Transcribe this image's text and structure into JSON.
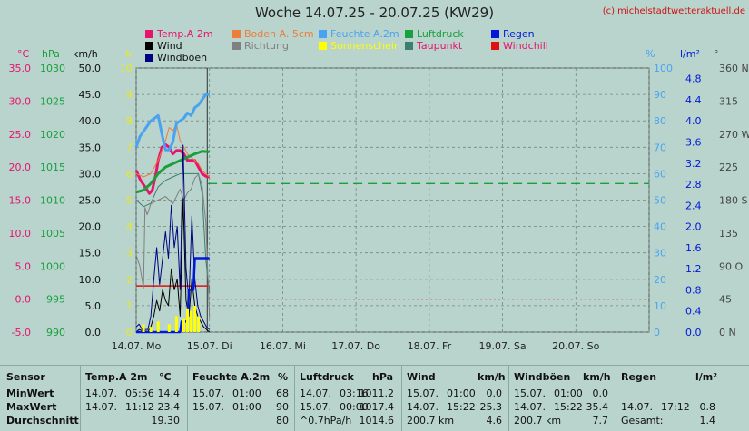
{
  "title": "Woche 14.07.25 - 20.07.25 (KW29)",
  "copyright": "(c) michelstadtwetteraktuell.de",
  "legend": [
    {
      "label": "Temp.A 2m",
      "color": "#e8136e",
      "text_color": "#e8136e"
    },
    {
      "label": "Boden A. 5cm",
      "color": "#ee7d3a",
      "text_color": "#ee7d3a"
    },
    {
      "label": "Feuchte A.2m",
      "color": "#4aa3f0",
      "text_color": "#4aa3f0"
    },
    {
      "label": "Luftdruck",
      "color": "#18a03c",
      "text_color": "#18a03c"
    },
    {
      "label": "Regen",
      "color": "#0018d8",
      "text_color": "#0018d8"
    },
    {
      "label": "Wind",
      "color": "#000000",
      "text_color": "#111111"
    },
    {
      "label": "Richtung",
      "color": "#808080",
      "text_color": "#808080"
    },
    {
      "label": "Sonnenschein",
      "color": "#ffff00",
      "text_color": "#ffff00"
    },
    {
      "label": "Taupunkt",
      "color": "#3e7e6e",
      "text_color": "#e8136e"
    },
    {
      "label": "Windchill",
      "color": "#e01010",
      "text_color": "#e8136e"
    },
    {
      "label": "Windböen",
      "color": "#000080",
      "text_color": "#111111"
    }
  ],
  "axis_units": {
    "celsius": "°C",
    "hpa": "hPa",
    "kmh": "km/h",
    "h": "h",
    "percent": "%",
    "rain": "l/m²",
    "deg": "°"
  },
  "chart_data": {
    "type": "line",
    "x_labels": [
      "14.07. Mo",
      "15.07. Di",
      "16.07. Mi",
      "17.07. Do",
      "18.07. Fr",
      "19.07. Sa",
      "20.07. So"
    ],
    "axes": {
      "celsius": {
        "ticks": [
          "35.0",
          "30.0",
          "25.0",
          "20.0",
          "15.0",
          "10.0",
          "5.0",
          "0.0",
          "-5.0"
        ],
        "range": [
          -5,
          35
        ]
      },
      "hpa": {
        "ticks": [
          "1030",
          "1025",
          "1020",
          "1015",
          "1010",
          "1005",
          "1000",
          "995",
          "990"
        ],
        "range": [
          990,
          1030
        ]
      },
      "kmh": {
        "ticks": [
          "50.0",
          "45.0",
          "40.0",
          "35.0",
          "30.0",
          "25.0",
          "20.0",
          "15.0",
          "10.0",
          "5.0",
          "0.0"
        ],
        "range": [
          0,
          50
        ]
      },
      "hours": {
        "ticks": [
          "10",
          "9",
          "8",
          "7",
          "6",
          "5",
          "4",
          "3",
          "2",
          "1",
          "0"
        ],
        "range": [
          0,
          10
        ]
      },
      "percent": {
        "ticks": [
          "100",
          "90",
          "80",
          "70",
          "60",
          "50",
          "40",
          "30",
          "20",
          "10",
          "0"
        ],
        "range": [
          0,
          100
        ]
      },
      "rain": {
        "ticks": [
          "4.8",
          "4.4",
          "4.0",
          "3.6",
          "3.2",
          "2.8",
          "2.4",
          "2.0",
          "1.6",
          "1.2",
          "0.8",
          "0.4",
          "0.0"
        ],
        "range": [
          0,
          5
        ]
      },
      "direction": {
        "ticks": [
          "360 N",
          "315",
          "270 W",
          "225",
          "180 S",
          "135",
          "90 O",
          "45",
          "0 N"
        ],
        "range": [
          0,
          360
        ]
      }
    },
    "series": [
      {
        "name": "Temp.A 2m",
        "axis": "celsius",
        "x": [
          0,
          0.06,
          0.12,
          0.18,
          0.22,
          0.27,
          0.3,
          0.35,
          0.4,
          0.45,
          0.5,
          0.55,
          0.6,
          0.65,
          0.7,
          0.75,
          0.8,
          0.85,
          0.9,
          0.95,
          1.0
        ],
        "values": [
          19.5,
          18,
          17,
          16,
          16.5,
          19,
          21,
          23,
          23.4,
          23,
          22,
          22.5,
          22.5,
          22,
          21,
          21,
          21,
          20,
          19,
          18.6,
          18.5
        ]
      },
      {
        "name": "Boden A. 5cm",
        "axis": "celsius",
        "x": [
          0,
          0.1,
          0.2,
          0.3,
          0.4,
          0.45,
          0.5,
          0.55,
          0.6,
          0.65,
          0.7,
          0.75,
          0.8,
          0.85,
          0.9,
          0.95,
          1.0
        ],
        "values": [
          19,
          18.5,
          19,
          21,
          24,
          26,
          25.5,
          26.5,
          24,
          23,
          22,
          21.5,
          21,
          20.5,
          19.5,
          19,
          18.5
        ]
      },
      {
        "name": "Feuchte A.2m",
        "axis": "percent",
        "x": [
          0,
          0.05,
          0.1,
          0.15,
          0.2,
          0.25,
          0.3,
          0.35,
          0.4,
          0.45,
          0.5,
          0.55,
          0.6,
          0.65,
          0.7,
          0.75,
          0.8,
          0.85,
          0.9,
          0.95,
          1.0
        ],
        "values": [
          70,
          74,
          76,
          78,
          80,
          81,
          82,
          75,
          69,
          69,
          72,
          79,
          80,
          81,
          83,
          82,
          85,
          86,
          88,
          90,
          90
        ]
      },
      {
        "name": "Luftdruck",
        "axis": "hpa",
        "x": [
          0,
          0.1,
          0.2,
          0.3,
          0.4,
          0.5,
          0.6,
          0.7,
          0.8,
          0.9,
          1.0
        ],
        "values": [
          1011.2,
          1011.5,
          1012.5,
          1014,
          1015,
          1015.5,
          1016,
          1016.5,
          1017,
          1017.4,
          1017.3
        ]
      },
      {
        "name": "Taupunkt",
        "axis": "celsius",
        "x": [
          0,
          0.1,
          0.2,
          0.3,
          0.4,
          0.5,
          0.6,
          0.7,
          0.8,
          0.85,
          0.9,
          0.95,
          1.0
        ],
        "values": [
          15,
          14,
          14.5,
          17,
          18,
          18.5,
          19,
          19,
          19,
          19,
          16,
          6,
          1
        ]
      },
      {
        "name": "Windchill",
        "axis": "celsius",
        "x": [
          0,
          0.5,
          1.0
        ],
        "values": [
          2,
          2,
          2
        ]
      },
      {
        "name": "Richtung",
        "axis": "direction",
        "x": [
          0,
          0.05,
          0.1,
          0.12,
          0.15,
          0.2,
          0.3,
          0.4,
          0.5,
          0.6,
          0.65,
          0.7,
          0.75,
          0.8,
          0.85,
          0.9,
          0.95,
          1.0
        ],
        "values": [
          105,
          90,
          60,
          170,
          160,
          175,
          180,
          185,
          175,
          195,
          180,
          190,
          195,
          210,
          215,
          200,
          150,
          20
        ]
      },
      {
        "name": "Wind",
        "axis": "kmh",
        "x": [
          0,
          0.04,
          0.08,
          0.12,
          0.16,
          0.2,
          0.24,
          0.28,
          0.32,
          0.36,
          0.4,
          0.44,
          0.48,
          0.52,
          0.56,
          0.6,
          0.64,
          0.68,
          0.72,
          0.76,
          0.8,
          0.84,
          0.88,
          0.92,
          0.96,
          1.0
        ],
        "values": [
          0,
          0.5,
          0.3,
          0.2,
          0.1,
          1,
          3,
          6,
          4,
          8,
          6,
          5,
          12,
          8,
          10,
          3,
          25.3,
          6,
          3,
          10,
          5,
          3,
          2,
          1,
          0.5,
          0
        ]
      },
      {
        "name": "Windböen",
        "axis": "kmh",
        "x": [
          0,
          0.04,
          0.08,
          0.12,
          0.16,
          0.2,
          0.24,
          0.28,
          0.32,
          0.36,
          0.4,
          0.44,
          0.48,
          0.52,
          0.56,
          0.6,
          0.64,
          0.68,
          0.72,
          0.76,
          0.8,
          0.84,
          0.88,
          0.92,
          0.96,
          1.0
        ],
        "values": [
          1,
          1.5,
          0.5,
          0.5,
          0.5,
          3,
          10,
          16,
          9,
          14,
          19,
          14,
          24,
          16,
          20,
          8,
          35.4,
          12,
          6,
          22,
          10,
          5,
          3,
          2,
          1,
          0.5
        ]
      },
      {
        "name": "Regen",
        "axis": "rain",
        "x": [
          0,
          0.6,
          0.62,
          0.7,
          0.72,
          0.78,
          0.8,
          1.0
        ],
        "values": [
          0,
          0,
          0.2,
          0.2,
          0.8,
          0.8,
          1.4,
          1.4
        ]
      },
      {
        "name": "Sonnenschein",
        "axis": "hours",
        "x": [
          0.1,
          0.2,
          0.3,
          0.45,
          0.55,
          0.65,
          0.7,
          0.75,
          0.8,
          0.85
        ],
        "values": [
          0.3,
          0.2,
          0.4,
          0.3,
          0.6,
          0.5,
          0.9,
          0.8,
          1.0,
          0.6
        ]
      }
    ],
    "grid": true,
    "current_time_x": 0.97,
    "reference_lines": [
      {
        "name": "green-dashed",
        "axis": "hpa",
        "value": 1012.5,
        "color": "#18a03c"
      },
      {
        "name": "red-dotted",
        "axis": "celsius",
        "value": 0,
        "color": "#d01010"
      }
    ]
  },
  "stats": {
    "sensor_col": {
      "header": "Sensor",
      "rows": [
        "MinWert",
        "MaxWert",
        "Durchschnitt"
      ]
    },
    "temp": {
      "header": "Temp.A 2m",
      "unit": "°C",
      "rows": [
        [
          "14.07.",
          "05:56",
          "14.4"
        ],
        [
          "14.07.",
          "11:12",
          "23.4"
        ],
        [
          "",
          "",
          "19.30"
        ]
      ]
    },
    "feuchte": {
      "header": "Feuchte A.2m",
      "unit": "%",
      "rows": [
        [
          "15.07.",
          "01:00",
          "68"
        ],
        [
          "15.07.",
          "01:00",
          "90"
        ],
        [
          "",
          "",
          "80"
        ]
      ]
    },
    "luftdruck": {
      "header": "Luftdruck",
      "unit": "hPa",
      "rows": [
        [
          "14.07.",
          "03:16",
          "1011.2"
        ],
        [
          "15.07.",
          "00:00",
          "1017.4"
        ],
        [
          "^0.7hPa/h",
          "",
          "1014.6"
        ]
      ]
    },
    "wind": {
      "header": "Wind",
      "unit": "km/h",
      "rows": [
        [
          "15.07.",
          "01:00",
          "0.0"
        ],
        [
          "14.07.",
          "15:22",
          "25.3"
        ],
        [
          "200.7 km",
          "",
          "4.6"
        ]
      ]
    },
    "windboeen": {
      "header": "Windböen",
      "unit": "km/h",
      "rows": [
        [
          "15.07.",
          "01:00",
          "0.0"
        ],
        [
          "14.07.",
          "15:22",
          "35.4"
        ],
        [
          "200.7 km",
          "",
          "7.7"
        ]
      ]
    },
    "regen": {
      "header": "Regen",
      "unit": "l/m²",
      "rows": [
        [
          "",
          "",
          ""
        ],
        [
          "14.07.",
          "17:12",
          "0.8"
        ],
        [
          "Gesamt:",
          "",
          "1.4"
        ]
      ]
    }
  }
}
